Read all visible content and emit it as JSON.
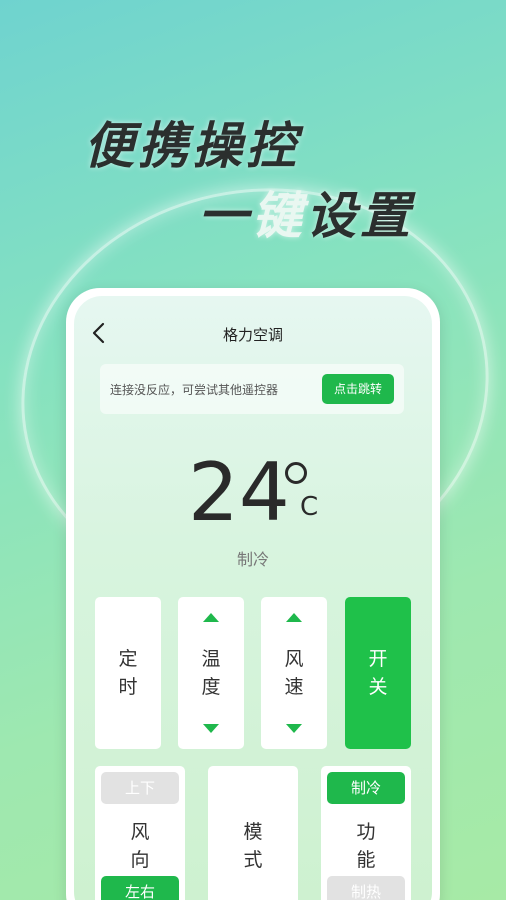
{
  "headline": {
    "line1": "便携操控",
    "line2_dark": "一",
    "line2_light": "键",
    "line2_rest": "设置"
  },
  "header": {
    "title": "格力空调"
  },
  "notice": {
    "text": "连接没反应，可尝试其他遥控器",
    "button": "点击跳转"
  },
  "display": {
    "temperature": "24",
    "unit": "C",
    "mode": "制冷"
  },
  "keys": {
    "timer": {
      "line1": "定",
      "line2": "时"
    },
    "temperature": {
      "line1": "温",
      "line2": "度"
    },
    "fan_speed": {
      "line1": "风",
      "line2": "速"
    },
    "power": {
      "line1": "开",
      "line2": "关"
    },
    "swing": {
      "line1": "风",
      "line2": "向",
      "top_option": "上下",
      "bottom_option": "左右"
    },
    "mode": {
      "line1": "模",
      "line2": "式"
    },
    "function": {
      "line1": "功",
      "line2": "能",
      "top_option": "制冷",
      "bottom_option": "制热"
    }
  },
  "colors": {
    "accent": "#1fb84c",
    "power": "#1fc14a"
  }
}
